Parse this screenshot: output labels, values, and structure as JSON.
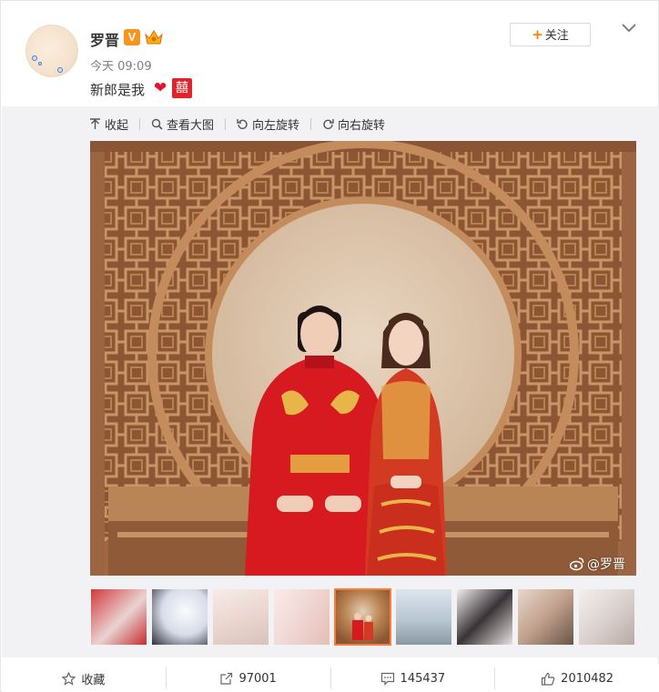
{
  "post": {
    "user_name": "罗晋",
    "verified_badge": "V",
    "time": "今天 09:09",
    "text": "新郎是我",
    "emoji_heart": "heart-icon",
    "emoji_xi": "囍",
    "follow_label": "关注"
  },
  "toolbar": {
    "collapse": "收起",
    "view_large": "查看大图",
    "rotate_left": "向左旋转",
    "rotate_right": "向右旋转"
  },
  "photo": {
    "watermark": "@罗晋"
  },
  "thumbnails": {
    "count": 9,
    "active_index": 4
  },
  "footer": {
    "favorite": "收藏",
    "repost_count": "97001",
    "comment_count": "145437",
    "like_count": "2010482"
  },
  "colors": {
    "accent": "#ff8200",
    "active_thumb": "#fa7d3c",
    "panel_bg": "#f2f2f5"
  }
}
